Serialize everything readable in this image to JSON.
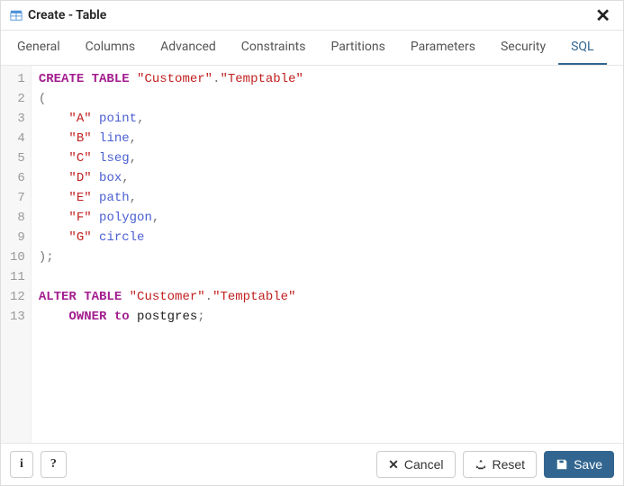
{
  "dialog": {
    "title": "Create - Table"
  },
  "tabs": [
    {
      "label": "General"
    },
    {
      "label": "Columns"
    },
    {
      "label": "Advanced"
    },
    {
      "label": "Constraints"
    },
    {
      "label": "Partitions"
    },
    {
      "label": "Parameters"
    },
    {
      "label": "Security"
    },
    {
      "label": "SQL",
      "active": true
    }
  ],
  "sql_tokens": {
    "create_table": "CREATE TABLE",
    "schema": "\"Customer\"",
    "table": "\"Temptable\"",
    "cols": [
      {
        "name": "\"A\"",
        "type": "point"
      },
      {
        "name": "\"B\"",
        "type": "line"
      },
      {
        "name": "\"C\"",
        "type": "lseg"
      },
      {
        "name": "\"D\"",
        "type": "box"
      },
      {
        "name": "\"E\"",
        "type": "path"
      },
      {
        "name": "\"F\"",
        "type": "polygon"
      },
      {
        "name": "\"G\"",
        "type": "circle"
      }
    ],
    "alter_table": "ALTER TABLE",
    "owner_to": "OWNER to",
    "owner": "postgres"
  },
  "line_numbers": [
    "1",
    "2",
    "3",
    "4",
    "5",
    "6",
    "7",
    "8",
    "9",
    "10",
    "11",
    "12",
    "13"
  ],
  "footer": {
    "info_label": "i",
    "help_label": "?",
    "cancel_label": "Cancel",
    "reset_label": "Reset",
    "save_label": "Save"
  }
}
